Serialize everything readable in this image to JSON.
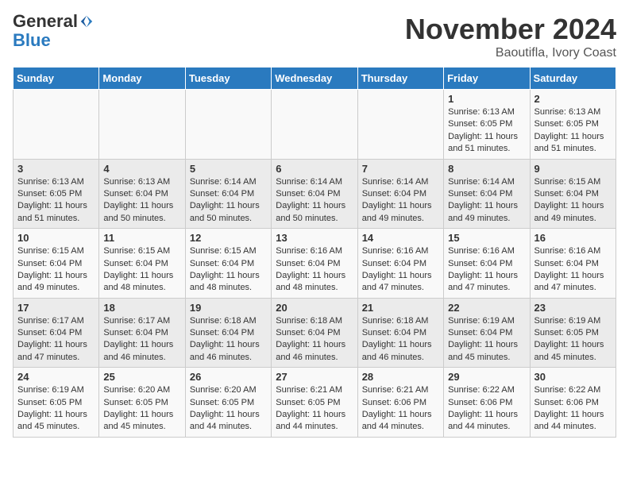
{
  "logo": {
    "general": "General",
    "blue": "Blue"
  },
  "header": {
    "month_title": "November 2024",
    "location": "Baoutifla, Ivory Coast"
  },
  "days_of_week": [
    "Sunday",
    "Monday",
    "Tuesday",
    "Wednesday",
    "Thursday",
    "Friday",
    "Saturday"
  ],
  "weeks": [
    [
      {
        "day": "",
        "info": ""
      },
      {
        "day": "",
        "info": ""
      },
      {
        "day": "",
        "info": ""
      },
      {
        "day": "",
        "info": ""
      },
      {
        "day": "",
        "info": ""
      },
      {
        "day": "1",
        "info": "Sunrise: 6:13 AM\nSunset: 6:05 PM\nDaylight: 11 hours and 51 minutes."
      },
      {
        "day": "2",
        "info": "Sunrise: 6:13 AM\nSunset: 6:05 PM\nDaylight: 11 hours and 51 minutes."
      }
    ],
    [
      {
        "day": "3",
        "info": "Sunrise: 6:13 AM\nSunset: 6:05 PM\nDaylight: 11 hours and 51 minutes."
      },
      {
        "day": "4",
        "info": "Sunrise: 6:13 AM\nSunset: 6:04 PM\nDaylight: 11 hours and 50 minutes."
      },
      {
        "day": "5",
        "info": "Sunrise: 6:14 AM\nSunset: 6:04 PM\nDaylight: 11 hours and 50 minutes."
      },
      {
        "day": "6",
        "info": "Sunrise: 6:14 AM\nSunset: 6:04 PM\nDaylight: 11 hours and 50 minutes."
      },
      {
        "day": "7",
        "info": "Sunrise: 6:14 AM\nSunset: 6:04 PM\nDaylight: 11 hours and 49 minutes."
      },
      {
        "day": "8",
        "info": "Sunrise: 6:14 AM\nSunset: 6:04 PM\nDaylight: 11 hours and 49 minutes."
      },
      {
        "day": "9",
        "info": "Sunrise: 6:15 AM\nSunset: 6:04 PM\nDaylight: 11 hours and 49 minutes."
      }
    ],
    [
      {
        "day": "10",
        "info": "Sunrise: 6:15 AM\nSunset: 6:04 PM\nDaylight: 11 hours and 49 minutes."
      },
      {
        "day": "11",
        "info": "Sunrise: 6:15 AM\nSunset: 6:04 PM\nDaylight: 11 hours and 48 minutes."
      },
      {
        "day": "12",
        "info": "Sunrise: 6:15 AM\nSunset: 6:04 PM\nDaylight: 11 hours and 48 minutes."
      },
      {
        "day": "13",
        "info": "Sunrise: 6:16 AM\nSunset: 6:04 PM\nDaylight: 11 hours and 48 minutes."
      },
      {
        "day": "14",
        "info": "Sunrise: 6:16 AM\nSunset: 6:04 PM\nDaylight: 11 hours and 47 minutes."
      },
      {
        "day": "15",
        "info": "Sunrise: 6:16 AM\nSunset: 6:04 PM\nDaylight: 11 hours and 47 minutes."
      },
      {
        "day": "16",
        "info": "Sunrise: 6:16 AM\nSunset: 6:04 PM\nDaylight: 11 hours and 47 minutes."
      }
    ],
    [
      {
        "day": "17",
        "info": "Sunrise: 6:17 AM\nSunset: 6:04 PM\nDaylight: 11 hours and 47 minutes."
      },
      {
        "day": "18",
        "info": "Sunrise: 6:17 AM\nSunset: 6:04 PM\nDaylight: 11 hours and 46 minutes."
      },
      {
        "day": "19",
        "info": "Sunrise: 6:18 AM\nSunset: 6:04 PM\nDaylight: 11 hours and 46 minutes."
      },
      {
        "day": "20",
        "info": "Sunrise: 6:18 AM\nSunset: 6:04 PM\nDaylight: 11 hours and 46 minutes."
      },
      {
        "day": "21",
        "info": "Sunrise: 6:18 AM\nSunset: 6:04 PM\nDaylight: 11 hours and 46 minutes."
      },
      {
        "day": "22",
        "info": "Sunrise: 6:19 AM\nSunset: 6:04 PM\nDaylight: 11 hours and 45 minutes."
      },
      {
        "day": "23",
        "info": "Sunrise: 6:19 AM\nSunset: 6:05 PM\nDaylight: 11 hours and 45 minutes."
      }
    ],
    [
      {
        "day": "24",
        "info": "Sunrise: 6:19 AM\nSunset: 6:05 PM\nDaylight: 11 hours and 45 minutes."
      },
      {
        "day": "25",
        "info": "Sunrise: 6:20 AM\nSunset: 6:05 PM\nDaylight: 11 hours and 45 minutes."
      },
      {
        "day": "26",
        "info": "Sunrise: 6:20 AM\nSunset: 6:05 PM\nDaylight: 11 hours and 44 minutes."
      },
      {
        "day": "27",
        "info": "Sunrise: 6:21 AM\nSunset: 6:05 PM\nDaylight: 11 hours and 44 minutes."
      },
      {
        "day": "28",
        "info": "Sunrise: 6:21 AM\nSunset: 6:06 PM\nDaylight: 11 hours and 44 minutes."
      },
      {
        "day": "29",
        "info": "Sunrise: 6:22 AM\nSunset: 6:06 PM\nDaylight: 11 hours and 44 minutes."
      },
      {
        "day": "30",
        "info": "Sunrise: 6:22 AM\nSunset: 6:06 PM\nDaylight: 11 hours and 44 minutes."
      }
    ]
  ]
}
